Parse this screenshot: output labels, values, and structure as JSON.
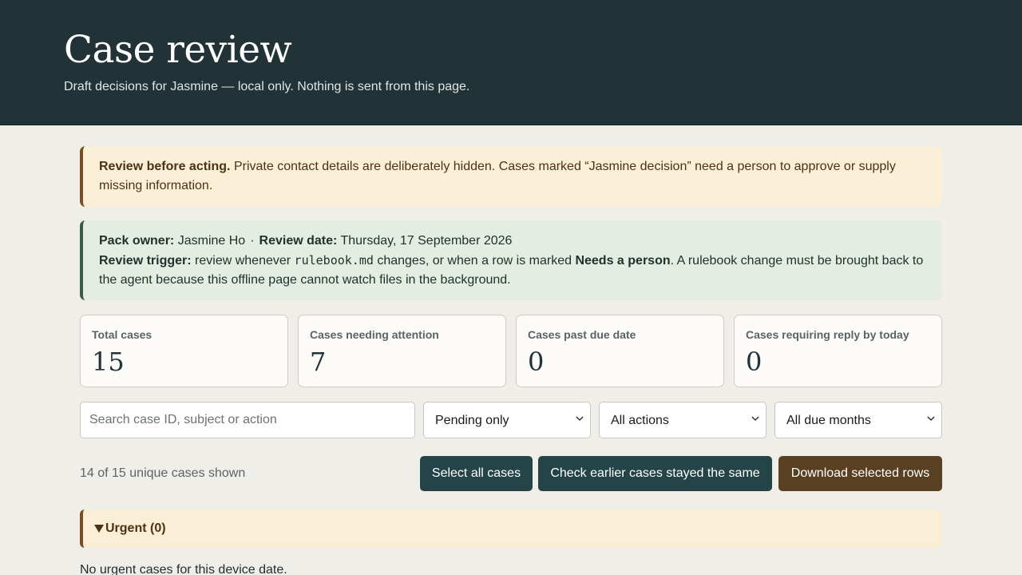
{
  "header": {
    "title": "Case review",
    "subtitle": "Draft decisions for Jasmine — local only. Nothing is sent from this page."
  },
  "warning": {
    "lead": "Review before acting.",
    "text": " Private contact details are deliberately hidden. Cases marked “Jasmine decision” need a person to approve or supply missing information."
  },
  "info": {
    "owner_label": "Pack owner:",
    "owner_value": " Jasmine Ho",
    "separator": "·",
    "date_label": "Review date:",
    "date_value": " Thursday, 17 September 2026",
    "trigger_label": "Review trigger:",
    "trigger_text_1": " review whenever ",
    "trigger_code": "rulebook.md",
    "trigger_text_2": " changes, or when a row is marked ",
    "trigger_strong": "Needs a person",
    "trigger_text_3": ". A rulebook change must be brought back to the agent because this offline page cannot watch files in the background."
  },
  "stats": [
    {
      "label": "Total cases",
      "value": "15"
    },
    {
      "label": "Cases needing attention",
      "value": "7"
    },
    {
      "label": "Cases past due date",
      "value": "0"
    },
    {
      "label": "Cases requiring reply by today",
      "value": "0"
    }
  ],
  "filters": {
    "search_placeholder": "Search case ID, subject or action",
    "search_value": "",
    "status": "Pending only",
    "action": "All actions",
    "month": "All due months"
  },
  "toolbar": {
    "count_text": "14 of 15 unique cases shown",
    "select_all": "Select all cases",
    "check_earlier": "Check earlier cases stayed the same",
    "download": "Download selected rows"
  },
  "urgent": {
    "title": "Urgent (0)",
    "empty_text": "No urgent cases for this device date."
  },
  "colors": {
    "header_bg": "#223338",
    "page_bg": "#f0eee9",
    "warning_bg": "#fbefd7",
    "info_bg": "#e4ede3",
    "button_dark": "#244447",
    "button_brown": "#5a4022"
  },
  "icons": {
    "select_chevron": "chevron-down-icon",
    "group_toggle": "triangle-down-icon"
  }
}
